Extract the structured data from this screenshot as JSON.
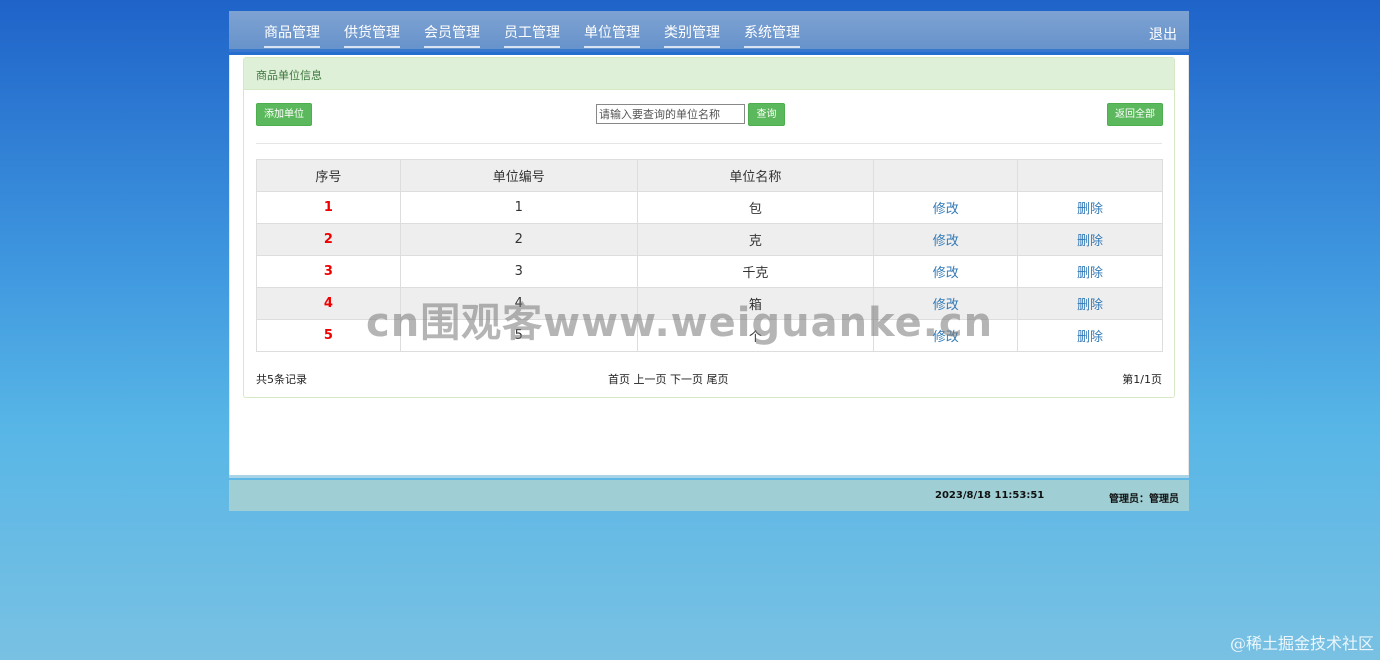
{
  "nav": {
    "items": [
      "商品管理",
      "供货管理",
      "会员管理",
      "员工管理",
      "单位管理",
      "类别管理",
      "系统管理"
    ],
    "logout": "退出"
  },
  "panel": {
    "title": "商品单位信息",
    "add_button": "添加单位",
    "search_placeholder": "请输入要查询的单位名称",
    "search_button": "查询",
    "show_all_button": "返回全部"
  },
  "table": {
    "headers": [
      "序号",
      "单位编号",
      "单位名称",
      "",
      ""
    ],
    "rows": [
      {
        "index": "1",
        "id": "1",
        "name": "包",
        "edit": "修改",
        "delete": "删除"
      },
      {
        "index": "2",
        "id": "2",
        "name": "克",
        "edit": "修改",
        "delete": "删除"
      },
      {
        "index": "3",
        "id": "3",
        "name": "千克",
        "edit": "修改",
        "delete": "删除"
      },
      {
        "index": "4",
        "id": "4",
        "name": "箱",
        "edit": "修改",
        "delete": "删除"
      },
      {
        "index": "5",
        "id": "5",
        "name": "个",
        "edit": "修改",
        "delete": "删除"
      }
    ]
  },
  "pagination": {
    "total": "共5条记录",
    "first": "首页",
    "prev": "上一页",
    "next": "下一页",
    "last": "尾页",
    "page_info": "第1/1页"
  },
  "status": {
    "datetime": "2023/8/18 11:53:51",
    "user": "管理员：管理员"
  },
  "watermark": "cn围观客www.weiguanke.cn",
  "corner_mark": "@稀土掘金技术社区"
}
